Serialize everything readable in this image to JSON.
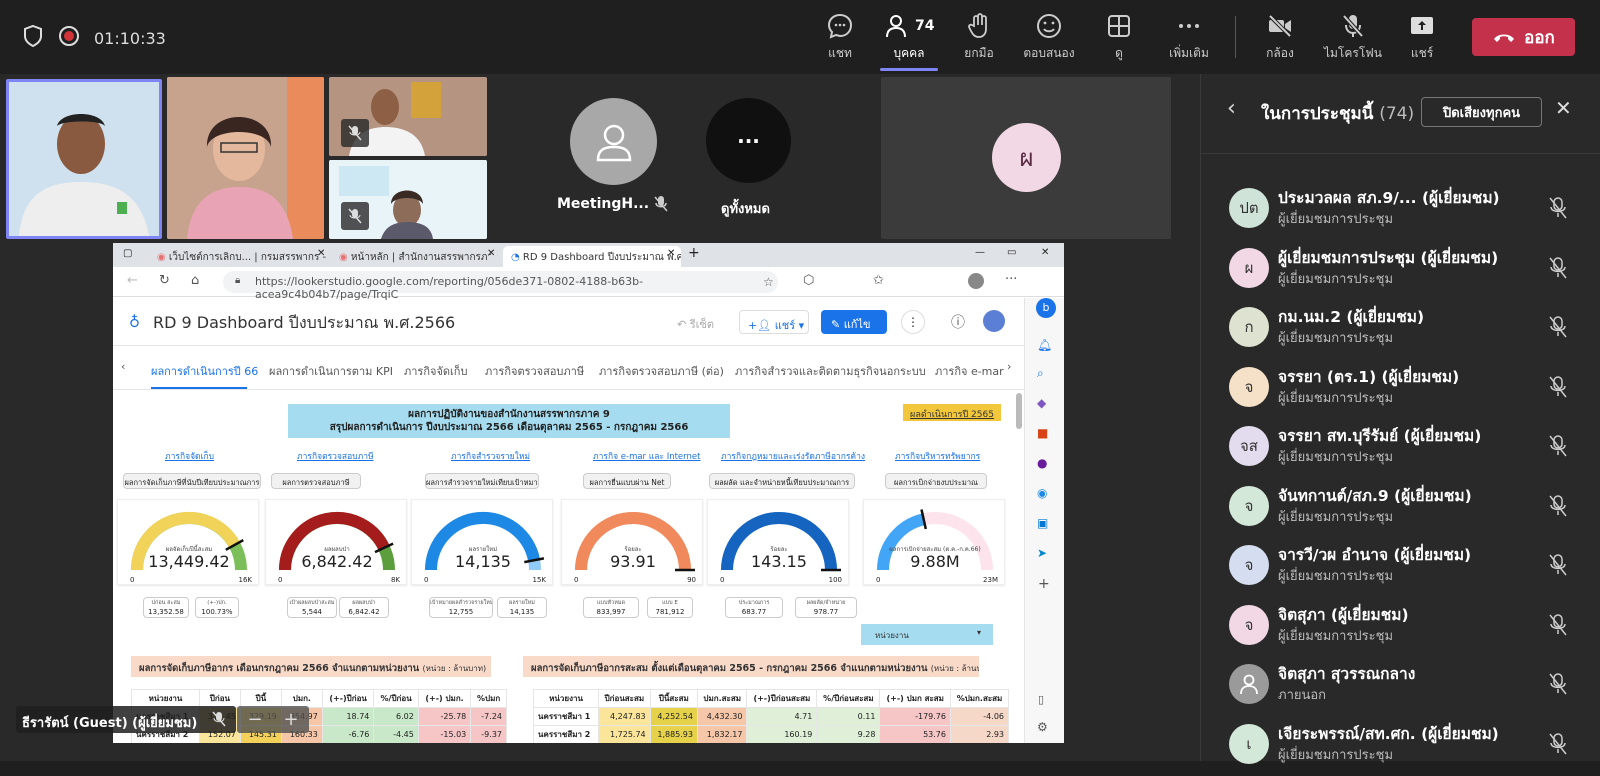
{
  "meeting": {
    "timer": "01:10:33"
  },
  "toolbar": {
    "chat": "แชท",
    "people": "บุคคล",
    "people_count": "74",
    "raise_hand": "ยกมือ",
    "react": "ตอบสนอง",
    "view": "ดู",
    "more": "เพิ่มเติม",
    "camera": "กล้อง",
    "mic": "ไมโครโฟน",
    "share": "แชร์",
    "leave": "ออก"
  },
  "stage": {
    "meeting_host_label": "MeetingH...",
    "view_all_label": "ดูทั้งหมด",
    "avatar_initial": "ผ",
    "presenter_name": "ธีรารัตน์ (Guest) (ผู้เยี่ยมชม)"
  },
  "panel": {
    "title": "ในการประชุมนี้",
    "count": "(74)",
    "mute_all": "ปิดเสียงทุกคน",
    "participants": [
      {
        "initials": "ปต",
        "name": "ประมวลผล สภ.9/... (ผู้เยี่ยมชม)",
        "role": "ผู้เยี่ยมชมการประชุม",
        "color": "#cfe3d8"
      },
      {
        "initials": "ผ",
        "name": "ผู้เยี่ยมชมการประชุม (ผู้เยี่ยมชม)",
        "role": "ผู้เยี่ยมชมการประชุม",
        "color": "#f1d8e4"
      },
      {
        "initials": "ก",
        "name": "กม.นม.2 (ผู้เยี่ยมชม)",
        "role": "ผู้เยี่ยมชมการประชุม",
        "color": "#dde3d0"
      },
      {
        "initials": "จ",
        "name": "จรรยา (ตร.1) (ผู้เยี่ยมชม)",
        "role": "ผู้เยี่ยมชมการประชุม",
        "color": "#f5e1c8"
      },
      {
        "initials": "จส",
        "name": "จรรยา สท.บุรีรัมย์ (ผู้เยี่ยมชม)",
        "role": "ผู้เยี่ยมชมการประชุม",
        "color": "#e3dcef"
      },
      {
        "initials": "จ",
        "name": "จันทกานต์/สภ.9 (ผู้เยี่ยมชม)",
        "role": "ผู้เยี่ยมชมการประชุม",
        "color": "#d3e8d8"
      },
      {
        "initials": "จ",
        "name": "จารวี/วผ อำนาจ (ผู้เยี่ยมชม)",
        "role": "ผู้เยี่ยมชมการประชุม",
        "color": "#d5def0"
      },
      {
        "initials": "จ",
        "name": "จิตสุภา (ผู้เยี่ยมชม)",
        "role": "ผู้เยี่ยมชมการประชุม",
        "color": "#f1d8e4"
      },
      {
        "initials": "",
        "name": "จิตสุภา สุวรรณกลาง",
        "role": "ภายนอก",
        "color": "#9a9a9a"
      },
      {
        "initials": "เ",
        "name": "เจียระพรรณ์/สท.ศก. (ผู้เยี่ยมชม)",
        "role": "ผู้เยี่ยมชมการประชุม",
        "color": "#d3e8d8"
      }
    ]
  },
  "browser": {
    "tabs": [
      "เว็บไซต์การเลิกบ... | กรมสรรพากร - Ti",
      "หน้าหลัก | สำนักงานสรรพากรภาค 9 -",
      "RD 9 Dashboard ปีงบประมาณ พ.ศ.2566"
    ],
    "url": "https://lookerstudio.google.com/reporting/056de371-0802-4188-b63b-acea9c4b04b7/page/TrqiC",
    "report_title": "RD 9 Dashboard ปีงบประมาณ พ.ศ.2566",
    "undo": "รีเซ็ต",
    "share": "แชร์",
    "edit": "แก้ไข",
    "page_tabs": [
      "ผลการดำเนินการปี 66",
      "ผลการดำเนินการตาม KPI",
      "ภารกิจจัดเก็บ",
      "ภารกิจตรวจสอบภาษี",
      "ภารกิจตรวจสอบภาษี (ต่อ)",
      "ภารกิจสำรวจและติดตามธุรกิจนอกระบบ",
      "ภารกิจ e-mar"
    ],
    "banner_line1": "ผลการปฏิบัติงานของสำนักงานสรรพากรภาค 9",
    "banner_line2": "สรุปผลการดำเนินการ ปีงบประมาณ 2566  เดือนตุลาคม 2565 - กรกฎาคม  2566",
    "year_button": "ผลดำเนินการปี 2565",
    "categories": [
      "ภารกิจจัดเก็บ",
      "ภารกิจตรวจสอบภาษี",
      "ภารกิจสำรวจรายใหม่",
      "ภารกิจ e-mar และ Internet",
      "ภารกิจกฎหมายและเร่งรัดภาษีอากรค้าง",
      "ภารกิจบริหารทรัพยากร"
    ],
    "cat_buttons": [
      "ผลการจัดเก็บภาษีที่นับปีเทียบประมาณการ",
      "ผลการตรวจสอบภาษี",
      "ผลการสำรวจรายใหม่เทียบเป้าหมาย",
      "ผลการยื่นแบบผ่าน Net",
      "ผลผลัด และจำหน่ายหนี้เทียบประมาณการ",
      "ผลการเบิกจ่ายงบประมาณ"
    ],
    "gauges": [
      {
        "label": "ผลจัดเก็บปีนี้สะสม",
        "value": "13,449.42",
        "min": "0",
        "max": "16K",
        "fraction": 0.84,
        "color": "#f2d35a",
        "track": "#7cbf5a"
      },
      {
        "label": "ผลผลบป่า",
        "value": "6,842.42",
        "min": "0",
        "max": "8K",
        "fraction": 0.86,
        "color": "#a51c1c",
        "track": "#5c9e3e"
      },
      {
        "label": "ผลรายใหม่",
        "value": "14,135",
        "min": "0",
        "max": "15K",
        "fraction": 0.94,
        "color": "#1e88e5",
        "track": "#90caf9"
      },
      {
        "label": "ร้อยละ",
        "value": "93.91",
        "min": "0",
        "max": "90",
        "fraction": 1.0,
        "color": "#f08a5d",
        "track": "#f8c6b0"
      },
      {
        "label": "ร้อยละ",
        "value": "143.15",
        "min": "0",
        "max": "100",
        "fraction": 1.0,
        "color": "#1565c0",
        "track": "#9ecbf5"
      },
      {
        "label": "ผลการเบิกจ่ายสะสม (ต.ค.-ก.ค.66)",
        "value": "9.88M",
        "min": "0",
        "max": "23M",
        "fraction": 0.43,
        "color": "#42a5f5",
        "track": "#fde3ec"
      }
    ],
    "minis": [
      {
        "a": "ปก่อน สะสม",
        "b": "13,352.58"
      },
      {
        "a": "(+-)ปก.",
        "b": "100.73%"
      },
      {
        "a": "เป้าผลผลบป่าสะสม",
        "b": "5,544"
      },
      {
        "a": "ผลผลบป่า",
        "b": "6,842.42"
      },
      {
        "a": "เป้าหมายผลสำรวจรายใหม่",
        "b": "12,755"
      },
      {
        "a": "ผลรายใหม่",
        "b": "14,135"
      },
      {
        "a": "แบบทั่วหมด",
        "b": "833,997"
      },
      {
        "a": "แบบ E",
        "b": "781,912"
      },
      {
        "a": "ประมาณการ",
        "b": "683.77"
      },
      {
        "a": "ผลผลัด/จำหน่าย",
        "b": "978.77"
      }
    ],
    "dropdown": "หน่วยงาน",
    "section1_title": "ผลการจัดเก็บภาษีอากร  เดือนกรกฎาคม 2566 จำแนกตามหน่วยงาน",
    "section1_unit": "(หน่วย : ล้านบาท)",
    "section2_title": "ผลการจัดเก็บภาษีอากรสะสม ตั้งแต่เดือนตุลาคม 2565 - กรกฎาคม 2566 จำแนกตามหน่วยงาน",
    "section2_unit": "(หน่วย : ล้านบาท)",
    "table1_header": [
      "หน่วยงาน",
      "ปีก่อน",
      "ปีนี้",
      "ปมก.",
      "(+-)ปีก่อน",
      "%/ปีก่อน",
      "(+-) ปมก.",
      "%ปมก"
    ],
    "table1_rows": [
      [
        "นครราชสีมา 1",
        "311.45",
        "329.19",
        "354.97",
        "18.74",
        "6.02",
        "-25.78",
        "-7.24"
      ],
      [
        "นครราชสีมา 2",
        "152.07",
        "145.31",
        "160.33",
        "-6.76",
        "-4.45",
        "-15.03",
        "-9.37"
      ]
    ],
    "table2_header": [
      "หน่วยงาน",
      "ปีก่อนสะสม",
      "ปีนี้สะสม",
      "ปมก.สะสม",
      "(+-)ปีก่อนสะสม",
      "%/ปีก่อนสะสม",
      "(+-) ปมก สะสม",
      "%ปมก.สะสม"
    ],
    "table2_rows": [
      [
        "นครราชสีมา 1",
        "4,247.83",
        "4,252.54",
        "4,432.30",
        "4.71",
        "0.11",
        "-179.76",
        "-4.06"
      ],
      [
        "นครราชสีมา 2",
        "1,725.74",
        "1,885.93",
        "1,832.17",
        "160.19",
        "9.28",
        "53.76",
        "2.93"
      ]
    ]
  }
}
